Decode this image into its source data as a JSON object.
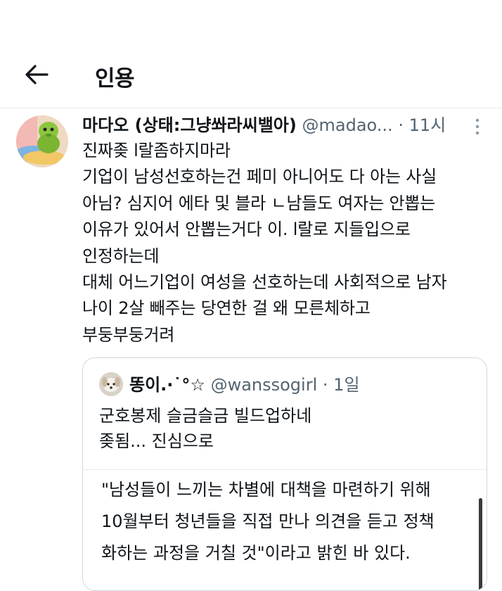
{
  "header": {
    "title": "인용"
  },
  "tweet": {
    "author_name": "마다오 (상태:그냥쏴라씨밸아)",
    "handle": "@madao...",
    "separator": "·",
    "time": "11시",
    "lines": [
      "진짜좆  l랄좀하지마라",
      "기업이 남성선호하는건 페미 아니어도 다 아는 사실",
      "아님? 심지어 에타 및 블라  ㄴ남들도 여자는 안뽑는",
      "이유가 있어서 안뽑는거다 이.  l랄로 지들입으로",
      "인정하는데",
      "대체 어느기업이 여성을 선호하는데 사회적으로 남자",
      "나이 2살 빼주는 당연한 걸 왜 모른체하고",
      "부둥부둥거려"
    ]
  },
  "quote": {
    "author_name": "똥이.·˙°☆",
    "handle": "@wanssogirl",
    "separator": "·",
    "time": "1일",
    "lines": [
      "군호봉제 슬금슬금 빌드업하네",
      "좆됨... 진심으로"
    ],
    "media_lines": [
      "\"남성들이 느끼는 차별에 대책을 마련하기 위해",
      "10월부터 청년들을 직접 만나 의견을 듣고 정책",
      "화하는 과정을 거칠 것\"이라고 밝힌 바 있다."
    ]
  },
  "icons": {
    "back": "back-arrow-icon",
    "more": "more-vertical-icon",
    "avatar": "green-character-avatar",
    "quote_avatar": "puppy-avatar"
  },
  "colors": {
    "text_primary": "#0f1419",
    "text_secondary": "#536471",
    "border": "#cfd9de"
  }
}
